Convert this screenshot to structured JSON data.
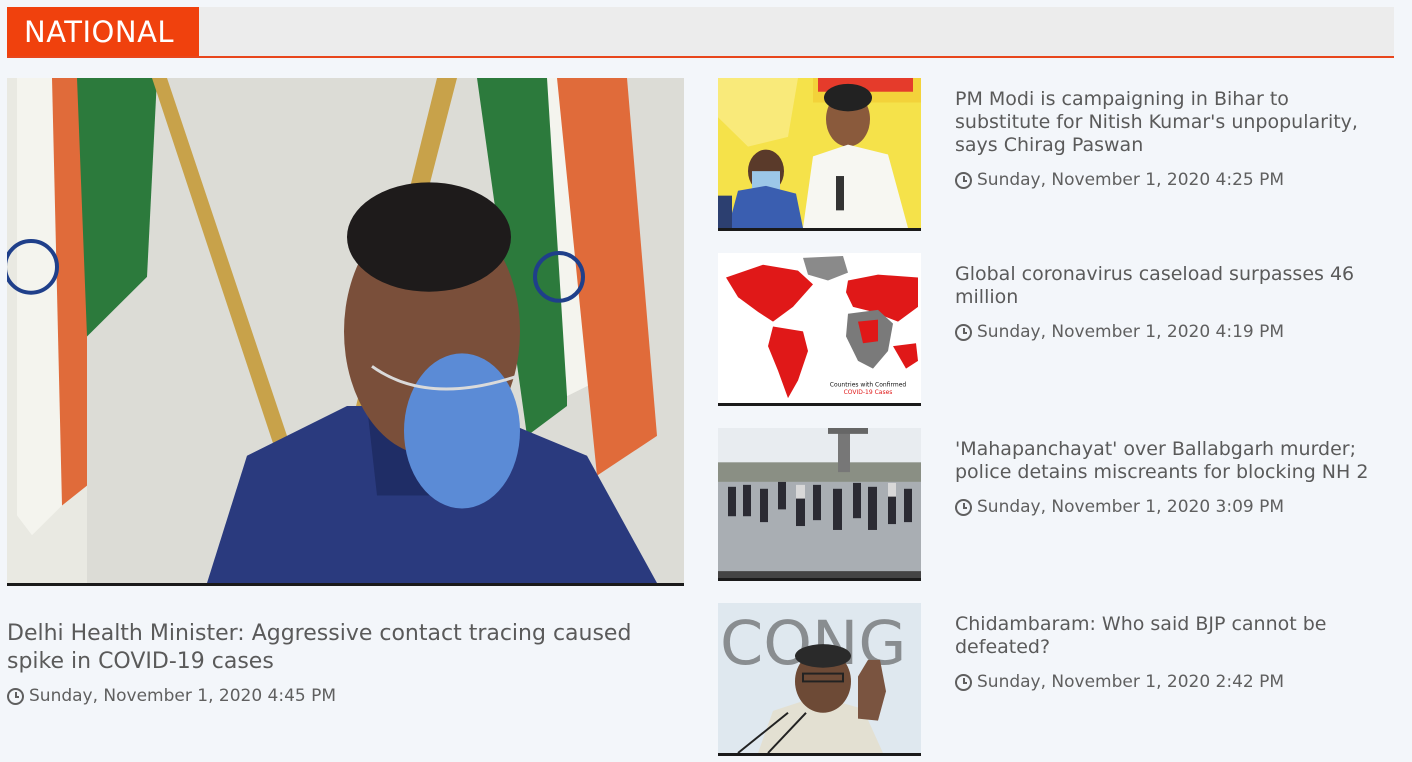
{
  "section": {
    "label": "NATIONAL"
  },
  "featured": {
    "title": "Delhi Health Minister: Aggressive contact tracing caused spike in COVID-19 cases",
    "date": "Sunday, November 1, 2020 4:45 PM"
  },
  "items": [
    {
      "title": "PM Modi is campaigning in Bihar to substitute for Nitish Kumar's unpopularity, says Chirag Paswan",
      "date": "Sunday, November 1, 2020 4:25 PM"
    },
    {
      "title": "Global coronavirus caseload surpasses 46 million",
      "date": "Sunday, November 1, 2020 4:19 PM",
      "thumb_caption_1": "Countries with Confirmed",
      "thumb_caption_2": "COVID-19 Cases"
    },
    {
      "title": "'Mahapanchayat' over Ballabgarh murder; police detains miscreants for blocking NH 2",
      "date": "Sunday, November 1, 2020 3:09 PM"
    },
    {
      "title": "Chidambaram: Who said BJP cannot be defeated?",
      "date": "Sunday, November 1, 2020 2:42 PM",
      "thumb_backdrop": "CONG"
    }
  ],
  "colors": {
    "accent": "#f0410d",
    "header_bg": "#ececec",
    "page_bg": "#f3f6fa"
  }
}
